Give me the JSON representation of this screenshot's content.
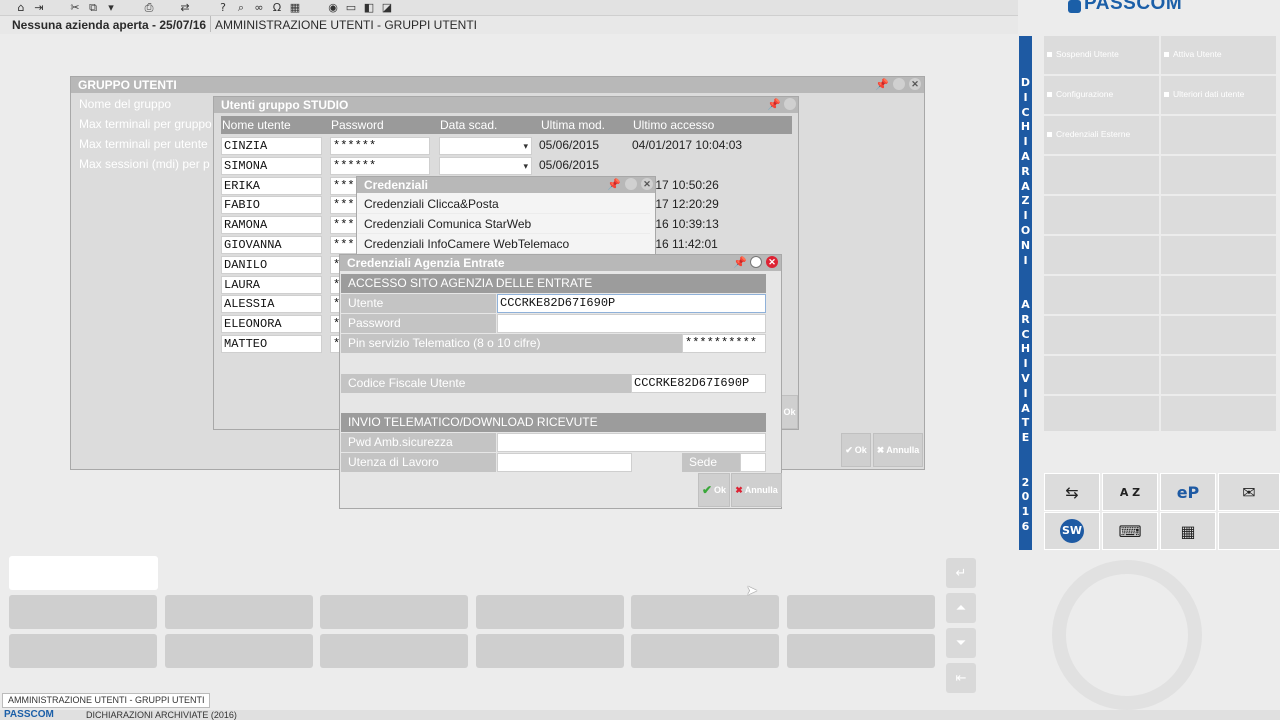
{
  "statusbar": {
    "company": "Nessuna azienda aperta - 25/07/16",
    "module": "AMMINISTRAZIONE UTENTI - GRUPPI UTENTI"
  },
  "logo": {
    "text": "PASSCOM"
  },
  "vertical_label": "DICHIARAZIONI ARCHIVIATE 2016",
  "side_buttons": [
    {
      "label": "Sospendi Utente"
    },
    {
      "label": "Attiva Utente"
    },
    {
      "label": "Configurazione"
    },
    {
      "label": "Ulteriori dati utente"
    },
    {
      "label": "Credenziali Esterne"
    }
  ],
  "group_window": {
    "title": "GRUPPO UTENTI",
    "labels": [
      "Nome del gruppo",
      "Max terminali per gruppo",
      "Max terminali per utente",
      "Max sessioni (mdi) per p"
    ],
    "ok_label": "Ok",
    "cancel_label": "Annulla"
  },
  "users_window": {
    "title": "Utenti gruppo STUDIO",
    "columns": [
      "Nome utente",
      "Password",
      "Data scad.",
      "Ultima mod.",
      "Ultimo accesso"
    ],
    "rows": [
      {
        "name": "CINZIA",
        "password": "******",
        "last_mod": "05/06/2015",
        "last_access": "04/01/2017 10:04:03"
      },
      {
        "name": "SIMONA",
        "password": "******",
        "last_mod": "05/06/2015",
        "last_access": ""
      },
      {
        "name": "ERIKA",
        "password": "***",
        "last_mod": "",
        "last_access": "2/2017 10:50:26"
      },
      {
        "name": "FABIO",
        "password": "***",
        "last_mod": "",
        "last_access": "1/2017 12:20:29"
      },
      {
        "name": "RAMONA",
        "password": "***",
        "last_mod": "",
        "last_access": "0/2016 10:39:13"
      },
      {
        "name": "GIOVANNA",
        "password": "***",
        "last_mod": "",
        "last_access": "9/2016 11:42:01"
      },
      {
        "name": "DANILO",
        "password": "*",
        "last_mod": "",
        "last_access": ""
      },
      {
        "name": "LAURA",
        "password": "*",
        "last_mod": "",
        "last_access": ""
      },
      {
        "name": "ALESSIA",
        "password": "*",
        "last_mod": "",
        "last_access": ""
      },
      {
        "name": "ELEONORA",
        "password": "*",
        "last_mod": "",
        "last_access": ""
      },
      {
        "name": "MATTEO",
        "password": "*",
        "last_mod": "",
        "last_access": ""
      }
    ],
    "ok_label": "Ok"
  },
  "credentials_menu": {
    "title": "Credenziali",
    "items": [
      "Credenziali Clicca&Posta",
      "Credenziali Comunica StarWeb",
      "Credenziali InfoCamere WebTelemaco"
    ]
  },
  "agenzia_dialog": {
    "title": "Credenziali Agenzia Entrate",
    "section1": "ACCESSO SITO AGENZIA DELLE ENTRATE",
    "utente_label": "Utente",
    "utente_value": "CCCRKE82D67I690P",
    "password_label": "Password",
    "password_value": "",
    "pin_label": "Pin servizio Telematico (8 o 10 cifre)",
    "pin_value": "**********",
    "cf_label": "Codice Fiscale Utente",
    "cf_value": "CCCRKE82D67I690P",
    "section2": "INVIO TELEMATICO/DOWNLOAD RICEVUTE",
    "pwd_amb_label": "Pwd Amb.sicurezza",
    "utenza_label": "Utenza di Lavoro",
    "sede_label": "Sede",
    "ok_label": "Ok",
    "cancel_label": "Annulla"
  },
  "bottom_tab": "AMMINISTRAZIONE UTENTI - GRUPPI UTENTI",
  "footer": {
    "logo": "PASSCOM",
    "text": "DICHIARAZIONI ARCHIVIATE (2016)"
  },
  "colors": {
    "accent": "#1e5aa3",
    "window_title": "#b8b8b8",
    "header": "#9a9a9a",
    "ok_green": "#3aa83a",
    "cancel_red": "#dd2233"
  }
}
